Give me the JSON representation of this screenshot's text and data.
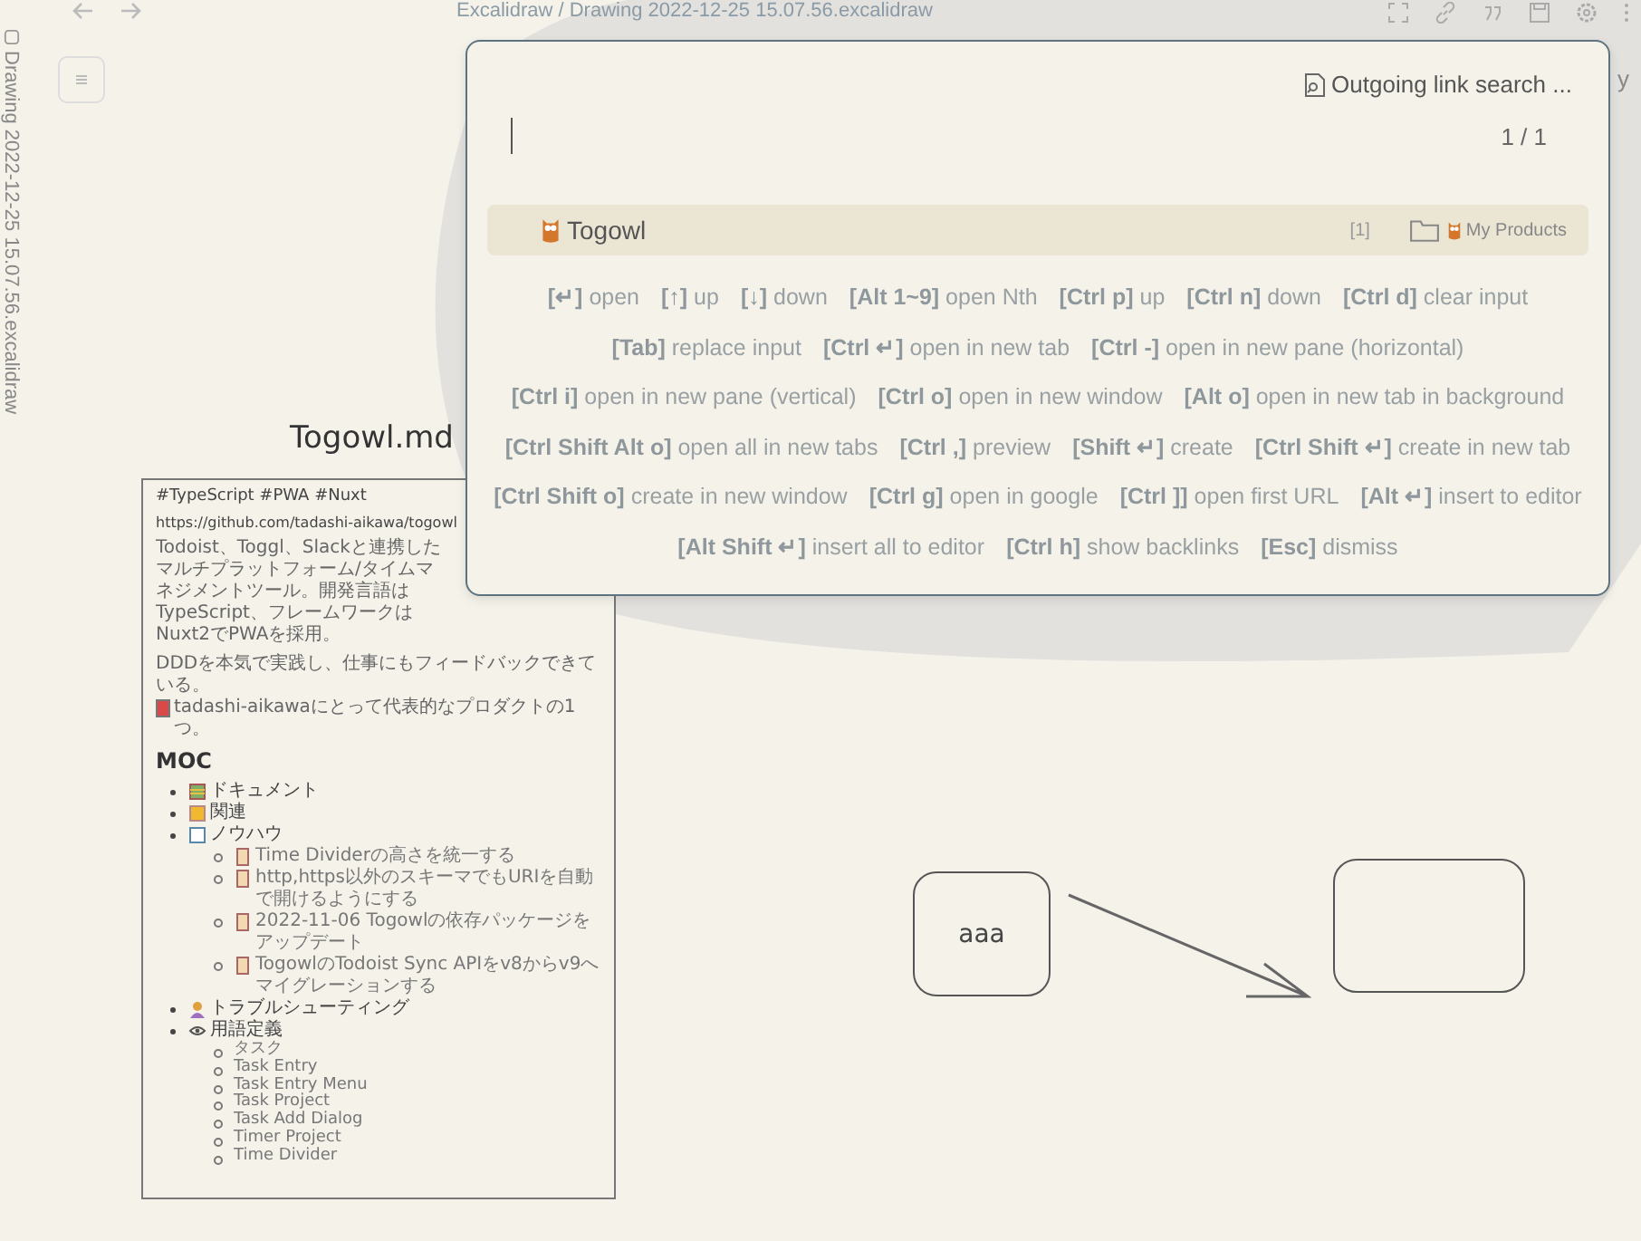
{
  "tab_header": {
    "breadcrumb": "Excalidraw / Drawing 2022-12-25 15.07.56.excalidraw"
  },
  "sidebar": {
    "file_title": "Drawing 2022-12-25 15.07.56.excalidraw"
  },
  "behind_button_text": "y",
  "canvas": {
    "embed_title": "Togowl.md",
    "note": {
      "tags": "#TypeScript #PWA #Nuxt",
      "url": "https://github.com/tadashi-aikawa/togowl",
      "paragraph_1": "Todoist、Toggl、Slackと連携したマルチプラットフォーム/タイムマネジメントツール。開発言語はTypeScript、フレームワークはNuxt2でPWAを採用。",
      "paragraph_2_before": "DDDを本気で実践し、仕事にもフィードバックできている。",
      "paragraph_2_after": "tadashi-aikawaにとって代表的なプロダクトの1つ。",
      "heading": "MOC",
      "list": [
        {
          "kind": "ledger",
          "text": "ドキュメント"
        },
        {
          "kind": "folder",
          "text": "関連"
        },
        {
          "kind": "page",
          "text": "ノウハウ",
          "children": [
            {
              "kind": "scroll",
              "text": "Time Dividerの高さを統一する"
            },
            {
              "kind": "scroll",
              "text": "http,https以外のスキーマでもURIを自動で開けるようにする"
            },
            {
              "kind": "scroll",
              "text": "2022-11-06 Togowlの依存パッケージをアップデート"
            },
            {
              "kind": "scroll",
              "text": "TogowlのTodoist Sync APIをv8からv9へマイグレーションする"
            }
          ]
        },
        {
          "kind": "person",
          "text": "トラブルシューティング"
        },
        {
          "kind": "eye",
          "text": "用語定義",
          "children": [
            {
              "kind": "plain",
              "text": "タスク"
            },
            {
              "kind": "plain",
              "text": "Task Entry"
            },
            {
              "kind": "plain",
              "text": "Task Entry Menu"
            },
            {
              "kind": "plain",
              "text": "Task Project"
            },
            {
              "kind": "plain",
              "text": "Task Add Dialog"
            },
            {
              "kind": "plain",
              "text": "Timer Project"
            },
            {
              "kind": "plain",
              "text": "Time Divider"
            }
          ]
        }
      ]
    },
    "shapes": [
      {
        "kind": "box",
        "label": "aaa"
      },
      {
        "kind": "arrow"
      },
      {
        "kind": "box"
      }
    ]
  },
  "switcher": {
    "mode_label": "Outgoing link search ...",
    "count": "1 / 1",
    "results": [
      {
        "title": "Togowl",
        "badge": "[1]",
        "folder": "My Products",
        "selected": true
      }
    ],
    "hints": [
      {
        "key": "[↵]",
        "action": "open"
      },
      {
        "key": "[↑]",
        "action": "up"
      },
      {
        "key": "[↓]",
        "action": "down"
      },
      {
        "key": "[Alt 1~9]",
        "action": "open Nth"
      },
      {
        "key": "[Ctrl p]",
        "action": "up"
      },
      {
        "key": "[Ctrl n]",
        "action": "down"
      },
      {
        "key": "[Ctrl d]",
        "action": "clear input"
      },
      {
        "key": "[Tab]",
        "action": "replace input"
      },
      {
        "key": "[Ctrl ↵]",
        "action": "open in new tab"
      },
      {
        "key": "[Ctrl -]",
        "action": "open in new pane (horizontal)"
      },
      {
        "key": "[Ctrl i]",
        "action": "open in new pane (vertical)"
      },
      {
        "key": "[Ctrl o]",
        "action": "open in new window"
      },
      {
        "key": "[Alt o]",
        "action": "open in new tab in background"
      },
      {
        "key": "[Ctrl Shift Alt o]",
        "action": "open all in new tabs"
      },
      {
        "key": "[Ctrl ,]",
        "action": "preview"
      },
      {
        "key": "[Shift ↵]",
        "action": "create"
      },
      {
        "key": "[Ctrl Shift ↵]",
        "action": "create in new tab"
      },
      {
        "key": "[Ctrl Shift o]",
        "action": "create in new window"
      },
      {
        "key": "[Ctrl g]",
        "action": "open in google"
      },
      {
        "key": "[Ctrl ]]",
        "action": "open first URL"
      },
      {
        "key": "[Alt ↵]",
        "action": "insert to editor"
      },
      {
        "key": "[Alt Shift ↵]",
        "action": "insert all to editor"
      },
      {
        "key": "[Ctrl h]",
        "action": "show backlinks"
      },
      {
        "key": "[Esc]",
        "action": "dismiss"
      }
    ]
  }
}
